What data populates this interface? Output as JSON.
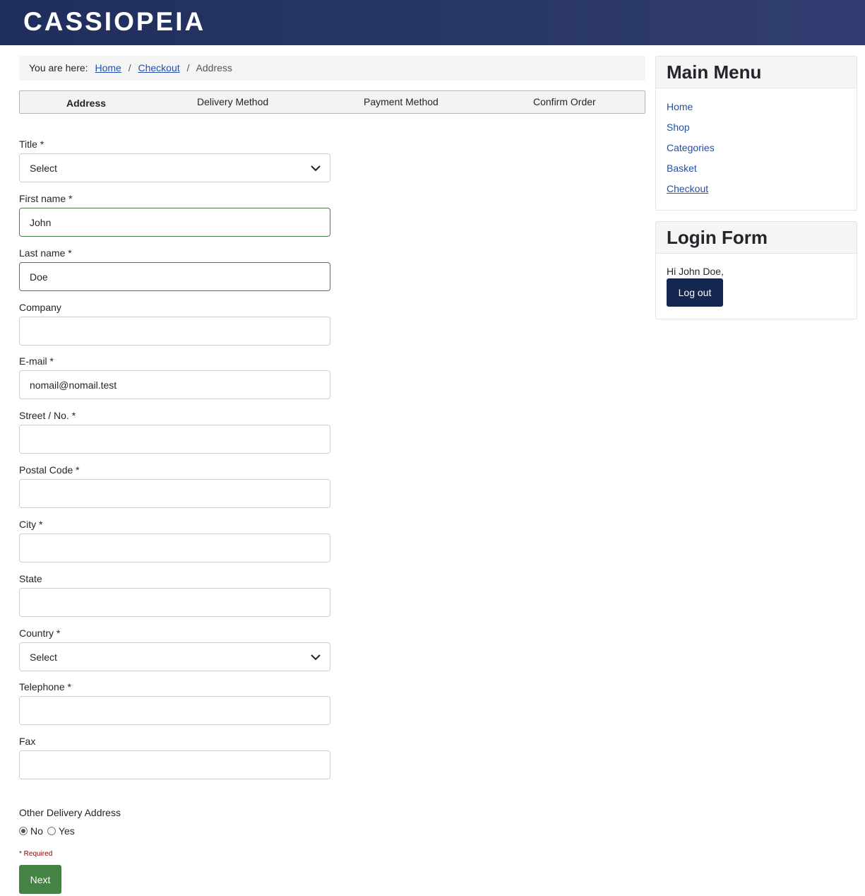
{
  "header": {
    "brand": "CASSIOPEIA"
  },
  "breadcrumb": {
    "prefix": "You are here:",
    "items": [
      "Home",
      "Checkout"
    ],
    "separator": "/",
    "current": "Address"
  },
  "steps": [
    {
      "label": "Address",
      "active": true
    },
    {
      "label": "Delivery Method",
      "active": false
    },
    {
      "label": "Payment Method",
      "active": false
    },
    {
      "label": "Confirm Order",
      "active": false
    }
  ],
  "form": {
    "title": {
      "label": "Title *",
      "value": "Select"
    },
    "first_name": {
      "label": "First name *",
      "value": "John"
    },
    "last_name": {
      "label": "Last name *",
      "value": "Doe"
    },
    "company": {
      "label": "Company",
      "value": ""
    },
    "email": {
      "label": "E-mail *",
      "value": "nomail@nomail.test"
    },
    "street": {
      "label": "Street / No. *",
      "value": ""
    },
    "postal_code": {
      "label": "Postal Code *",
      "value": ""
    },
    "city": {
      "label": "City *",
      "value": ""
    },
    "state": {
      "label": "State",
      "value": ""
    },
    "country": {
      "label": "Country *",
      "value": "Select"
    },
    "telephone": {
      "label": "Telephone *",
      "value": ""
    },
    "fax": {
      "label": "Fax",
      "value": ""
    },
    "other_delivery": {
      "label": "Other Delivery Address",
      "options": [
        "No",
        "Yes"
      ],
      "selected": "No"
    },
    "required_note": "* Required",
    "next_label": "Next"
  },
  "sidebar": {
    "main_menu": {
      "title": "Main Menu",
      "items": [
        "Home",
        "Shop",
        "Categories",
        "Basket",
        "Checkout"
      ],
      "current": "Checkout"
    },
    "login_form": {
      "title": "Login Form",
      "greeting": "Hi John Doe,",
      "logout_label": "Log out"
    }
  },
  "colors": {
    "header_bg": "#1f2e5d",
    "link": "#224faa",
    "valid_border": "#448344",
    "next_button": "#448344",
    "logout_button": "#132750",
    "required_text": "#8b0000"
  }
}
